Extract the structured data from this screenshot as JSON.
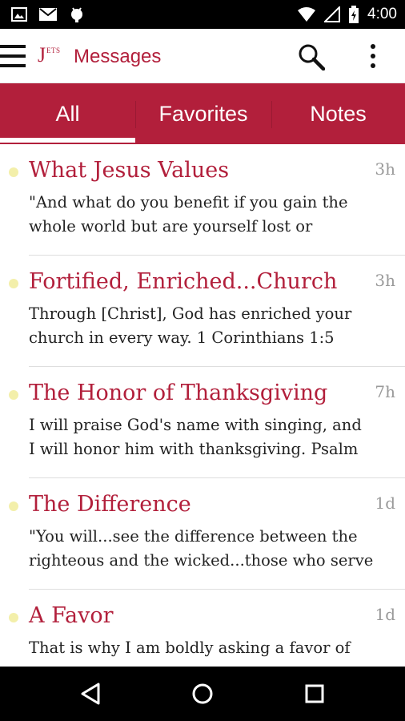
{
  "status_bar": {
    "time": "4:00",
    "left_icons": [
      "image-icon",
      "mail-icon",
      "android-icon"
    ],
    "right_icons": [
      "wifi-icon",
      "signal-icon",
      "battery-icon"
    ]
  },
  "app_bar": {
    "logo_big": "J",
    "logo_small": "ETS",
    "title": "Messages",
    "accent_color": "#b21f3b"
  },
  "tabs": [
    {
      "label": "All",
      "selected": true
    },
    {
      "label": "Favorites",
      "selected": false
    },
    {
      "label": "Notes",
      "selected": false
    }
  ],
  "messages": [
    {
      "title": "What Jesus Values",
      "time": "3h",
      "line1": "\"And what do you benefit if you gain the",
      "line2": "whole world but are yourself lost or"
    },
    {
      "title": "Fortified, Enriched...Church",
      "time": "3h",
      "line1": "Through [Christ], God has enriched your",
      "line2": "church in every way. 1 Corinthians 1:5"
    },
    {
      "title": "The Honor of Thanksgiving",
      "time": "7h",
      "line1": "I will praise God's name with singing, and",
      "line2": "I will honor him with thanksgiving. Psalm"
    },
    {
      "title": "The Difference",
      "time": "1d",
      "line1": "\"You will...see the difference between the",
      "line2": "righteous and the wicked...those who serve"
    },
    {
      "title": "A Favor",
      "time": "1d",
      "line1": "That is why I am boldly asking a favor of",
      "line2": ""
    }
  ],
  "nav_bar": [
    "back-icon",
    "home-icon",
    "recents-icon"
  ]
}
